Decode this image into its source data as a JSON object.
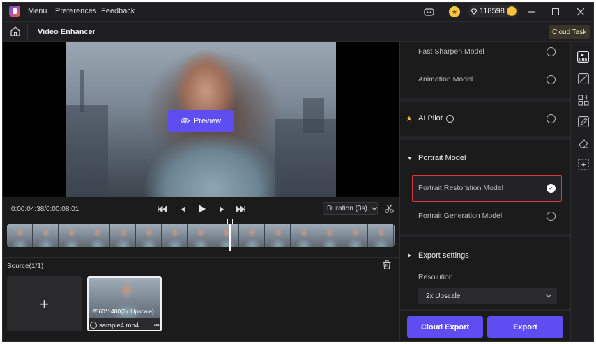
{
  "titlebar": {
    "menu": [
      "Menu",
      "Preferences",
      "Feedback"
    ],
    "credits": "118598",
    "icons": [
      "discord-icon",
      "coin-icon",
      "diamond-icon",
      "user-avatar-icon",
      "minimize-icon",
      "maximize-icon",
      "close-icon"
    ]
  },
  "header": {
    "title": "Video Enhancer",
    "cloud_task": "Cloud Task"
  },
  "preview": {
    "button_label": "Preview"
  },
  "playback": {
    "timecode": "0:00:04:38/0:00:08:01",
    "duration_label": "Duration (3s)"
  },
  "source": {
    "label": "Source(1/1)",
    "add_symbol": "+",
    "clip": {
      "resolution": "2560*1480(2x Upscale)",
      "name": "sample4.mp4",
      "more": "•••"
    }
  },
  "settings": {
    "models_top": [
      {
        "label": "Fast Sharpen Model",
        "selected": false
      },
      {
        "label": "Animation Model",
        "selected": false
      }
    ],
    "ai_pilot": {
      "label": "AI Pilot",
      "info": "i",
      "selected": false
    },
    "portrait": {
      "section": "Portrait Model",
      "models": [
        {
          "label": "Portrait Restoration Model",
          "selected": true
        },
        {
          "label": "Portrait Generation Model",
          "selected": false
        }
      ]
    },
    "export": {
      "section": "Export settings",
      "resolution_label": "Resolution",
      "resolution_value": "2x Upscale"
    },
    "buttons": {
      "cloud_export": "Cloud Export",
      "export": "Export"
    }
  },
  "rail": {
    "items": [
      "uhd-icon",
      "curve-icon",
      "grid-add-icon",
      "edit-icon",
      "eraser-icon",
      "select-ai-icon"
    ],
    "uhd_text": "UHD"
  },
  "colors": {
    "accent": "#5e4ef2",
    "selected_border": "#e0353a",
    "background": "#1b1b1c"
  }
}
